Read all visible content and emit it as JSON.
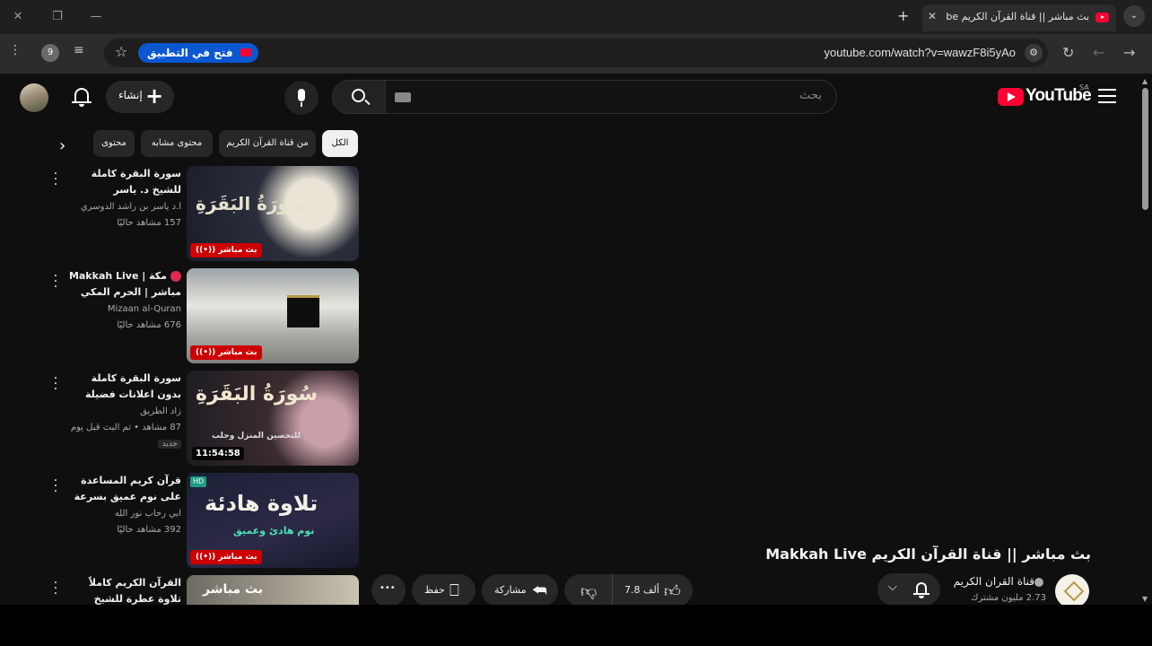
{
  "browser": {
    "tab_title": "بث مباشر || قناة القرآن الكريم be",
    "new_tab_label": "+",
    "close_tab_label": "✕",
    "window_close": "✕",
    "window_restore": "❐",
    "window_minimize": "—",
    "tab_menu": "⌄",
    "url": "youtube.com/watch?v=wawzF8i5yAo",
    "open_app_label": "فتح في التطبيق",
    "profile_count": "9"
  },
  "header": {
    "logo_text": "YouTube",
    "region": "SA",
    "search_placeholder": "بحث",
    "create_label": "إنشاء",
    "create_plus": "+"
  },
  "chips": [
    {
      "label": "الكل",
      "active": true
    },
    {
      "label": "من قناة القرآن الكريم",
      "active": false
    },
    {
      "label": "محتوى مشابه",
      "active": false
    },
    {
      "label": "محتوى",
      "active": false
    }
  ],
  "chips_arrow": "›",
  "recommendations": [
    {
      "title": "سورة البقرة كاملة للشيخ د. ياسر الدوسري - Surat Al-...",
      "channel": "أ.د ياسر بن راشد الدوسري",
      "stats": "157 مشاهد حاليًا",
      "thumb_text": "سُورَةُ البَقَرَةِ",
      "badge": "((•)) بث مباشر"
    },
    {
      "title": "مكة | Makkah Live مباشر | الحرم المكي مباشر...",
      "channel": "Mizaan al-Quran",
      "stats": "676 مشاهد حاليًا",
      "thumb_text": "",
      "badge": "((•)) بث مباشر"
    },
    {
      "title": "سورة البقرة كاملة بدون اعلانات فضيلة الشيخ سعو...",
      "channel": "زاد الطريق",
      "stats": "87 مشاهد • تم البث قبل يوم واحد",
      "extra": "جديد",
      "thumb_text": "سُورَةُ البَقَرَةِ",
      "thumb_sub": "للتحصين المنزل وجلب",
      "duration": "11:54:58"
    },
    {
      "title": "قرآن كريم المساعدة على نوم عميق بسرعة - نوم هادئ...",
      "channel": "ابي رحاب نور الله",
      "stats": "392 مشاهد حاليًا",
      "thumb_text": "تلاوة هادئة",
      "thumb_sub": "نوم هادئ وعميق",
      "hd": "HD",
      "badge": "((•)) بث مباشر"
    },
    {
      "title": "القرآن الكريم كاملاً تلاوة عطرة للشيخ مشاري راشد...",
      "channel": "",
      "stats": "",
      "thumb_text": "بث مباشر"
    }
  ],
  "video": {
    "title": "بث مباشر || قناة القرآن الكريم Makkah Live",
    "channel_name": "قناة القران الكريم",
    "subscribers": "2.73 مليون مشترك",
    "likes": "7.8 ألف",
    "share_label": "مشاركة",
    "save_label": "حفظ",
    "more_label": "•••"
  },
  "colors": {
    "accent": "#ff0033",
    "background": "#0f0f0f",
    "chip": "#272727",
    "app_button": "#0b57d0"
  }
}
